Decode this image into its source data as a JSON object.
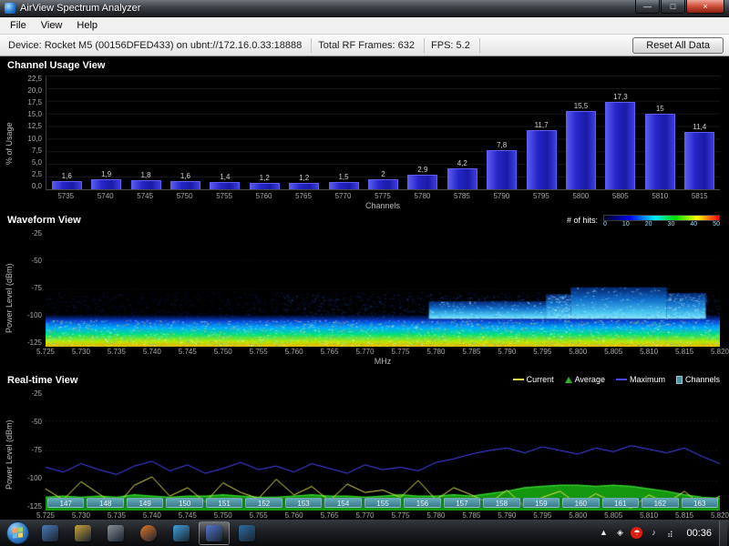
{
  "window": {
    "title": "AirView Spectrum Analyzer",
    "menu": [
      "File",
      "View",
      "Help"
    ],
    "controls": {
      "minimize": "—",
      "maximize": "□",
      "close": "×"
    },
    "statusbar": {
      "device": "Device: Rocket M5 (00156DFED433) on ubnt://172.16.0.33:18888",
      "frames": "Total RF Frames: 632",
      "fps": "FPS: 5.2",
      "reset_button": "Reset All Data"
    }
  },
  "chart_data": [
    {
      "id": "channel_usage",
      "type": "bar",
      "title": "Channel Usage View",
      "xlabel": "Channels",
      "ylabel": "% of Usage",
      "ylim": [
        0,
        22.5
      ],
      "grid": true,
      "y_tick_labels": [
        "22,5",
        "20,0",
        "17,5",
        "15,0",
        "12,5",
        "10,0",
        "7,5",
        "5,0",
        "2,5",
        "0,0"
      ],
      "categories": [
        "5735",
        "5740",
        "5745",
        "5750",
        "5755",
        "5760",
        "5765",
        "5770",
        "5775",
        "5780",
        "5785",
        "5790",
        "5795",
        "5800",
        "5805",
        "5810",
        "5815"
      ],
      "values": [
        1.6,
        1.9,
        1.8,
        1.6,
        1.4,
        1.2,
        1.2,
        1.5,
        2,
        2.9,
        4.2,
        7.8,
        11.7,
        15.5,
        17.3,
        15,
        11.4
      ],
      "value_labels": [
        "1,6",
        "1,9",
        "1,8",
        "1,6",
        "1,4",
        "1,2",
        "1,2",
        "1,5",
        "2",
        "2,9",
        "4,2",
        "7,8",
        "11,7",
        "15,5",
        "17,3",
        "15",
        "11,4"
      ],
      "bar_color": "#2526c8"
    },
    {
      "id": "waveform",
      "type": "heatmap",
      "title": "Waveform View",
      "xlabel": "MHz",
      "ylabel": "Power Level (dBm)",
      "xlim": [
        5.725,
        5.82
      ],
      "ylim": [
        -125,
        -25
      ],
      "x_tick_labels": [
        "5.725",
        "5.730",
        "5.735",
        "5.740",
        "5.745",
        "5.750",
        "5.755",
        "5.760",
        "5.765",
        "5.770",
        "5.775",
        "5.780",
        "5.785",
        "5.790",
        "5.795",
        "5.800",
        "5.805",
        "5.810",
        "5.815",
        "5.820"
      ],
      "y_tick_labels": [
        "-25",
        "-50",
        "-75",
        "-100",
        "-125"
      ],
      "legend": {
        "label": "# of hits:",
        "ticks": [
          "0",
          "10",
          "20",
          "30",
          "40",
          "50"
        ],
        "gradient": [
          "#000022",
          "#0000ee",
          "#00eaff",
          "#00e000",
          "#ffff00",
          "#ff0000"
        ]
      },
      "noise_floor_band": {
        "top_dbm": -100,
        "bottom_dbm": -125
      },
      "signal_steps": [
        {
          "x0": 5.779,
          "x1": 5.7955,
          "top_dbm": -86
        },
        {
          "x0": 5.7955,
          "x1": 5.799,
          "top_dbm": -80
        },
        {
          "x0": 5.799,
          "x1": 5.8125,
          "top_dbm": -74
        },
        {
          "x0": 5.8125,
          "x1": 5.818,
          "top_dbm": -79
        }
      ]
    },
    {
      "id": "realtime",
      "type": "line",
      "title": "Real-time View",
      "ylabel": "Power Level (dBm)",
      "xlim": [
        5.725,
        5.82
      ],
      "ylim": [
        -125,
        -25
      ],
      "x_tick_labels": [
        "5.725",
        "5.730",
        "5.735",
        "5.740",
        "5.745",
        "5.750",
        "5.755",
        "5.760",
        "5.765",
        "5.770",
        "5.775",
        "5.780",
        "5.785",
        "5.790",
        "5.795",
        "5.800",
        "5.805",
        "5.810",
        "5.815",
        "5.820"
      ],
      "y_tick_labels": [
        "-25",
        "-50",
        "-75",
        "-100",
        "-125"
      ],
      "legend": [
        {
          "label": "Current",
          "color": "#e3e34e",
          "swatch": "line"
        },
        {
          "label": "Average",
          "color": "#2bb22b",
          "swatch": "triangle"
        },
        {
          "label": "Maximum",
          "color": "#4747ff",
          "swatch": "line"
        },
        {
          "label": "Channels",
          "color": "#4d93a6",
          "swatch": "box"
        }
      ],
      "channels": [
        "147",
        "148",
        "149",
        "150",
        "151",
        "152",
        "153",
        "154",
        "155",
        "156",
        "157",
        "158",
        "159",
        "160",
        "161",
        "162",
        "163"
      ],
      "series": [
        {
          "name": "Maximum",
          "color": "#4747ff",
          "values": [
            -89,
            -93,
            -86,
            -91,
            -95,
            -88,
            -84,
            -92,
            -87,
            -94,
            -90,
            -85,
            -91,
            -88,
            -93,
            -86,
            -90,
            -94,
            -87,
            -91,
            -89,
            -92,
            -85,
            -82,
            -78,
            -75,
            -73,
            -77,
            -72,
            -75,
            -78,
            -73,
            -76,
            -71,
            -74,
            -77,
            -73,
            -80,
            -86
          ]
        },
        {
          "name": "Average",
          "color": "#14960f",
          "fill": true,
          "values": [
            -114,
            -113,
            -114,
            -113,
            -114,
            -112,
            -113,
            -114,
            -113,
            -113,
            -112,
            -113,
            -114,
            -114,
            -113,
            -112,
            -113,
            -113,
            -114,
            -113,
            -112,
            -113,
            -113,
            -112,
            -113,
            -111,
            -109,
            -106,
            -105,
            -104,
            -104,
            -105,
            -104,
            -105,
            -107,
            -109,
            -112,
            -114,
            -115
          ]
        },
        {
          "name": "Current",
          "color": "#e3e34e",
          "values": [
            -107,
            -116,
            -101,
            -111,
            -121,
            -104,
            -97,
            -113,
            -106,
            -118,
            -102,
            -110,
            -115,
            -99,
            -112,
            -105,
            -117,
            -103,
            -110,
            -108,
            -114,
            -100,
            -116,
            -106,
            -112,
            -119,
            -108,
            -122,
            -114,
            -109,
            -120,
            -111,
            -118,
            -123,
            -112,
            -119,
            -109,
            -121,
            -113
          ]
        }
      ]
    }
  ],
  "taskbar": {
    "clock": "00:36",
    "apps": [
      {
        "name": "taskbar-app-1",
        "color": "#4a7ab5"
      },
      {
        "name": "taskbar-app-2",
        "color": "#c9a23a"
      },
      {
        "name": "taskbar-app-3",
        "color": "#8a8f96"
      },
      {
        "name": "taskbar-app-browser",
        "color": "#e0762a",
        "shape": "circle"
      },
      {
        "name": "taskbar-app-4",
        "color": "#3fa0dc"
      },
      {
        "name": "taskbar-app-airview",
        "color": "#5577cc",
        "active": true
      },
      {
        "name": "taskbar-app-5",
        "color": "#2e6da0"
      }
    ],
    "tray": [
      {
        "name": "tray-expand-icon",
        "glyph": "▲"
      },
      {
        "name": "tray-app-icon",
        "glyph": "◈"
      },
      {
        "name": "tray-avira-icon",
        "glyph": "☂",
        "style": "avira"
      },
      {
        "name": "tray-volume-icon",
        "glyph": "♪"
      },
      {
        "name": "tray-network-icon",
        "glyph": "⣴"
      }
    ]
  }
}
